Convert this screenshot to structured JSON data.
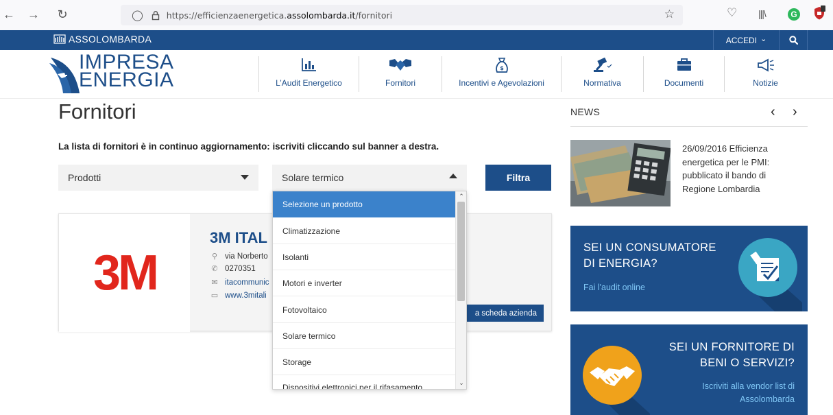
{
  "browser": {
    "url_prefix": "https://efficienzaenergetica.",
    "url_domain": "assolombarda.it",
    "url_path": "/fornitori"
  },
  "topbar": {
    "org": "ASSOLOMBARDA",
    "login_label": "ACCEDI",
    "login_caret": "⌄"
  },
  "brand": {
    "line1": "IMPRESA",
    "line2": "ENERGIA"
  },
  "menu": [
    {
      "label": "L’Audit Energetico",
      "icon": "chart-icon"
    },
    {
      "label": "Fornitori",
      "icon": "handshake-icon",
      "active": true
    },
    {
      "label": "Incentivi e Agevolazioni",
      "icon": "money-bag-icon"
    },
    {
      "label": "Normativa",
      "icon": "gavel-icon"
    },
    {
      "label": "Documenti",
      "icon": "briefcase-icon"
    },
    {
      "label": "Notizie",
      "icon": "megaphone-icon"
    }
  ],
  "page": {
    "title": "Fornitori",
    "intro": "La lista di fornitori è in continuo aggiornamento: iscriviti cliccando sul banner a destra."
  },
  "filters": {
    "category_value": "Prodotti",
    "product_value": "Solare termico",
    "submit_label": "Filtra",
    "product_options": [
      "Selezione un prodotto",
      "Climatizzazione",
      "Isolanti",
      "Motori e inverter",
      "Fotovoltaico",
      "Solare termico",
      "Storage",
      "Dispositivi elettronici per il rifasamento"
    ],
    "highlighted_option": "Selezione un prodotto"
  },
  "company": {
    "logo_text": "3M",
    "name": "3M ITAL",
    "address": "via Norberto",
    "phone": "0270351",
    "email": "itacommunic",
    "website": "www.3mitali",
    "details_label": "a scheda azienda"
  },
  "news": {
    "heading": "NEWS",
    "item_text": "26/09/2016 Efficienza energetica per le PMI: pubblicato il bando di Regione Lombardia"
  },
  "promos": [
    {
      "title_line1": "SEI UN CONSUMATORE",
      "title_line2": "DI ENERGIA?",
      "link": "Fai l'audit online",
      "icon": "checklist-icon"
    },
    {
      "title_line1": "SEI UN FORNITORE DI",
      "title_line2": "BENI O SERVIZI?",
      "link_line1": "Iscriviti alla vendor list di",
      "link_line2": "Assolombarda",
      "icon": "handshake-icon"
    }
  ],
  "colors": {
    "brand_blue": "#1d4e89",
    "highlight_blue": "#3b82cb",
    "badge_teal": "#3aa6c4",
    "badge_orange": "#f0a21b",
    "logo_red": "#e1261c"
  }
}
